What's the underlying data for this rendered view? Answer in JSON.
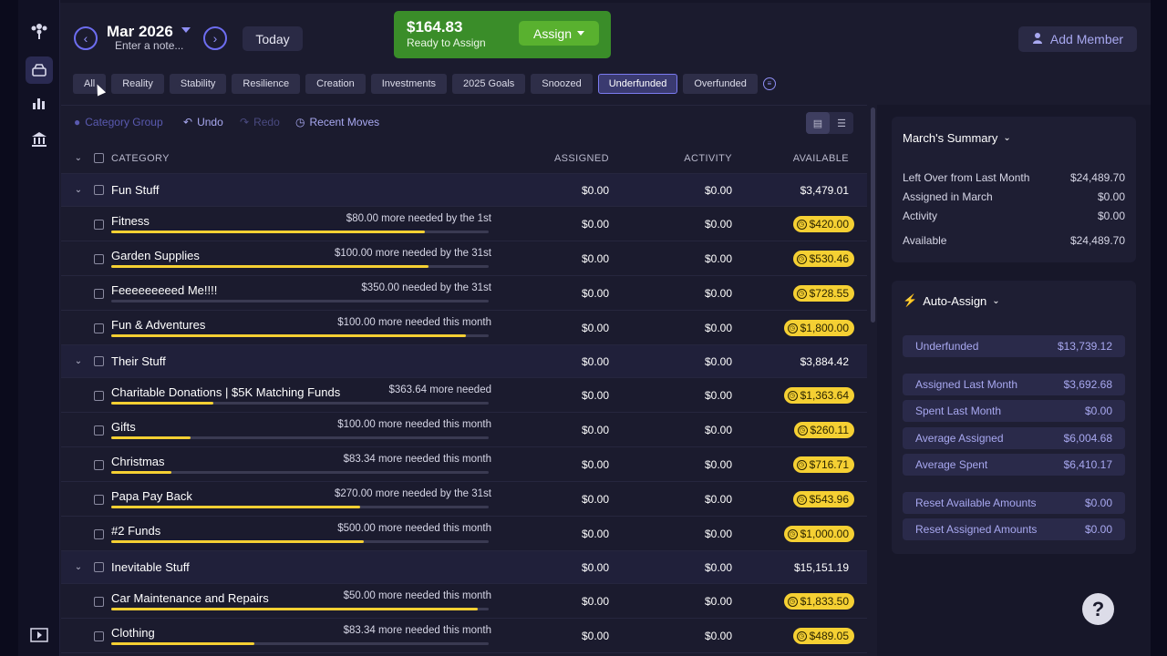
{
  "header": {
    "month": "Mar 2026",
    "note_placeholder": "Enter a note...",
    "today_label": "Today",
    "ready_to_assign_amount": "$164.83",
    "ready_to_assign_label": "Ready to Assign",
    "assign_label": "Assign",
    "add_member_label": "Add Member"
  },
  "filters": [
    "All",
    "Reality",
    "Stability",
    "Resilience",
    "Creation",
    "Investments",
    "2025 Goals",
    "Snoozed",
    "Underfunded",
    "Overfunded"
  ],
  "selected_filter": "Underfunded",
  "toolbar": {
    "category_group": "Category Group",
    "undo": "Undo",
    "redo": "Redo",
    "recent_moves": "Recent Moves"
  },
  "columns": {
    "category": "CATEGORY",
    "assigned": "ASSIGNED",
    "activity": "ACTIVITY",
    "available": "AVAILABLE"
  },
  "groups": [
    {
      "name": "Fun Stuff",
      "assigned": "$0.00",
      "activity": "$0.00",
      "available": "$3,479.01",
      "items": [
        {
          "name": "Fitness",
          "need": "$80.00 more needed by the 1st",
          "progress": 0.83,
          "assigned": "$0.00",
          "activity": "$0.00",
          "available": "$420.00"
        },
        {
          "name": "Garden Supplies",
          "need": "$100.00 more needed by the 31st",
          "progress": 0.84,
          "assigned": "$0.00",
          "activity": "$0.00",
          "available": "$530.46"
        },
        {
          "name": "Feeeeeeeeed Me!!!!",
          "need": "$350.00 needed by the 31st",
          "progress": 0.0,
          "assigned": "$0.00",
          "activity": "$0.00",
          "available": "$728.55"
        },
        {
          "name": "Fun & Adventures",
          "need": "$100.00 more needed this month",
          "progress": 0.94,
          "assigned": "$0.00",
          "activity": "$0.00",
          "available": "$1,800.00"
        }
      ]
    },
    {
      "name": "Their Stuff",
      "assigned": "$0.00",
      "activity": "$0.00",
      "available": "$3,884.42",
      "items": [
        {
          "name": "Charitable Donations | $5K Matching Funds",
          "need": "$363.64 more needed",
          "progress": 0.27,
          "assigned": "$0.00",
          "activity": "$0.00",
          "available": "$1,363.64"
        },
        {
          "name": "Gifts",
          "need": "$100.00 more needed this month",
          "progress": 0.21,
          "assigned": "$0.00",
          "activity": "$0.00",
          "available": "$260.11"
        },
        {
          "name": "Christmas",
          "need": "$83.34 more needed this month",
          "progress": 0.16,
          "assigned": "$0.00",
          "activity": "$0.00",
          "available": "$716.71"
        },
        {
          "name": "Papa Pay Back",
          "need": "$270.00 more needed by the 31st",
          "progress": 0.66,
          "assigned": "$0.00",
          "activity": "$0.00",
          "available": "$543.96"
        },
        {
          "name": "#2 Funds",
          "need": "$500.00 more needed this month",
          "progress": 0.67,
          "assigned": "$0.00",
          "activity": "$0.00",
          "available": "$1,000.00"
        }
      ]
    },
    {
      "name": "Inevitable Stuff",
      "assigned": "$0.00",
      "activity": "$0.00",
      "available": "$15,151.19",
      "items": [
        {
          "name": "Car Maintenance and Repairs",
          "need": "$50.00 more needed this month",
          "progress": 0.97,
          "assigned": "$0.00",
          "activity": "$0.00",
          "available": "$1,833.50"
        },
        {
          "name": "Clothing",
          "need": "$83.34 more needed this month",
          "progress": 0.38,
          "assigned": "$0.00",
          "activity": "$0.00",
          "available": "$489.05"
        }
      ]
    }
  ],
  "summary": {
    "title": "March's Summary",
    "rows": [
      {
        "label": "Left Over from Last Month",
        "value": "$24,489.70"
      },
      {
        "label": "Assigned in March",
        "value": "$0.00"
      },
      {
        "label": "Activity",
        "value": "$0.00"
      },
      {
        "label": "Available",
        "value": "$24,489.70"
      }
    ]
  },
  "auto_assign": {
    "title": "Auto-Assign",
    "items": [
      {
        "label": "Underfunded",
        "value": "$13,739.12"
      },
      {
        "label": "Assigned Last Month",
        "value": "$3,692.68"
      },
      {
        "label": "Spent Last Month",
        "value": "$0.00"
      },
      {
        "label": "Average Assigned",
        "value": "$6,004.68"
      },
      {
        "label": "Average Spent",
        "value": "$6,410.17"
      },
      {
        "label": "Reset Available Amounts",
        "value": "$0.00"
      },
      {
        "label": "Reset Assigned Amounts",
        "value": "$0.00"
      }
    ]
  },
  "help_label": "?",
  "colors": {
    "accent": "#6d6df0",
    "ready_green": "#3a8d29",
    "underfunded_yellow": "#f5d033",
    "background": "#1b1b2e"
  }
}
